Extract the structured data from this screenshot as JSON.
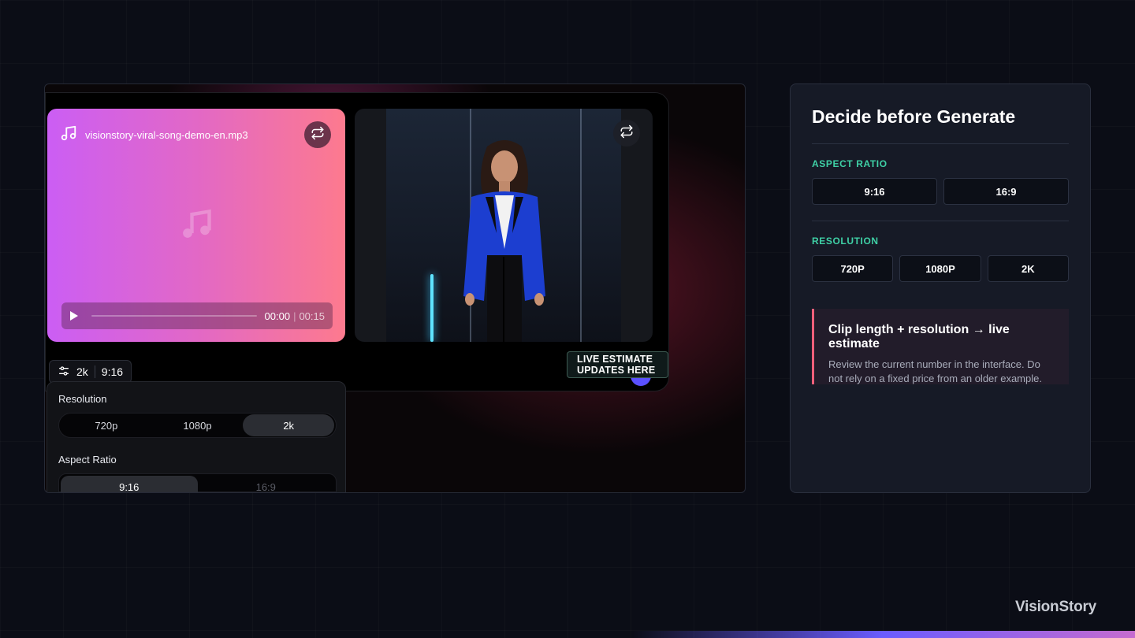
{
  "audio": {
    "filename": "visionstory-viral-song-demo-en.mp3",
    "time_current": "00:00",
    "time_separator": "|",
    "time_total": "00:15",
    "progress": 0
  },
  "settings_chip": {
    "resolution": "2k",
    "aspect": "9:16"
  },
  "live_tag": "LIVE ESTIMATE UPDATES HERE",
  "popover": {
    "resolution_label": "Resolution",
    "resolution_options": [
      "720p",
      "1080p",
      "2k"
    ],
    "resolution_selected": "2k",
    "aspect_label": "Aspect Ratio",
    "aspect_options": [
      "9:16",
      "16:9"
    ],
    "aspect_selected": "9:16"
  },
  "panel": {
    "title": "Decide before Generate",
    "aspect_label": "ASPECT RATIO",
    "aspect_options": [
      "9:16",
      "16:9"
    ],
    "resolution_label": "RESOLUTION",
    "resolution_options": [
      "720P",
      "1080P",
      "2K"
    ],
    "note_title": "Clip length + resolution → live estimate",
    "note_body": "Review the current number in the interface. Do not rely on a fixed price from an older example."
  },
  "brand": "VisionStory",
  "colors": {
    "accent_green": "#3fd1a6",
    "accent_pink": "#f0607a",
    "audio_gradient_start": "#cb5ef4",
    "audio_gradient_end": "#fd7a8e"
  }
}
